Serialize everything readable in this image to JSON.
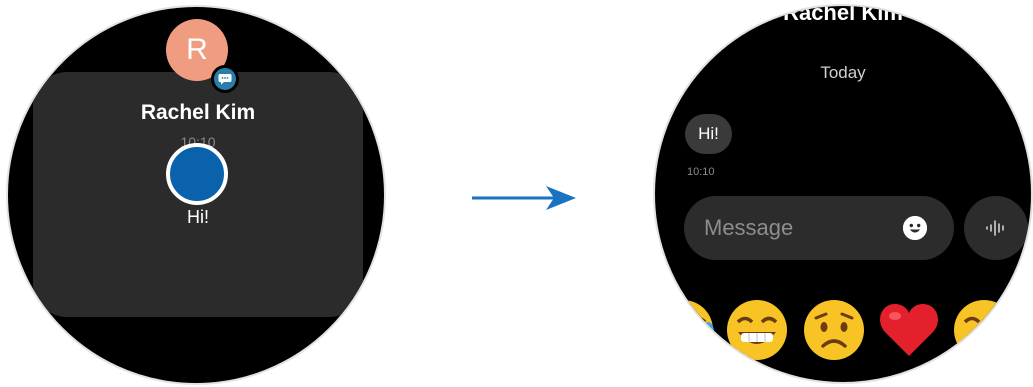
{
  "notification": {
    "avatar_initial": "R",
    "sender": "Rachel Kim",
    "time": "10:10",
    "message": "Hi!"
  },
  "conversation": {
    "title": "Rachel Kim",
    "date_header": "Today",
    "messages": [
      {
        "text": "Hi!",
        "time": "10:10"
      }
    ],
    "input_placeholder": "Message",
    "quick_emojis": [
      "crying-laughing",
      "grinning",
      "worried",
      "red-heart",
      "partial-emoji"
    ]
  },
  "colors": {
    "background": "#000000",
    "card": "#2b2b2b",
    "avatar": "#ef9c80",
    "touch_indicator": "#0a62ad",
    "arrow": "#1a73c0",
    "badge": "#2a7fa8"
  }
}
